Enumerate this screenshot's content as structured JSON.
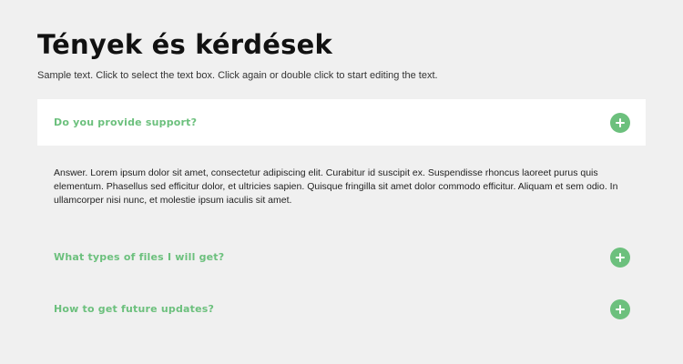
{
  "heading": {
    "title": "Tények és kérdések",
    "subtitle": "Sample text. Click to select the text box. Click again or double click to start editing the text."
  },
  "faq": {
    "items": [
      {
        "question": "Do you provide support?",
        "expanded": true
      },
      {
        "question": "What types of files I will get?",
        "expanded": false
      },
      {
        "question": "How to get future updates?",
        "expanded": false
      }
    ],
    "answer": "Answer. Lorem ipsum dolor sit amet, consectetur adipiscing elit. Curabitur id suscipit ex. Suspendisse rhoncus laoreet purus quis elementum. Phasellus sed efficitur dolor, et ultricies sapien. Quisque fringilla sit amet dolor commodo efficitur. Aliquam et sem odio. In ullamcorper nisi nunc, et molestie ipsum iaculis sit amet.",
    "icon": "plus-circle-icon"
  },
  "colors": {
    "accent": "#6cc07d",
    "background": "#f0f0f0",
    "active_panel": "#ffffff",
    "title": "#111111"
  }
}
